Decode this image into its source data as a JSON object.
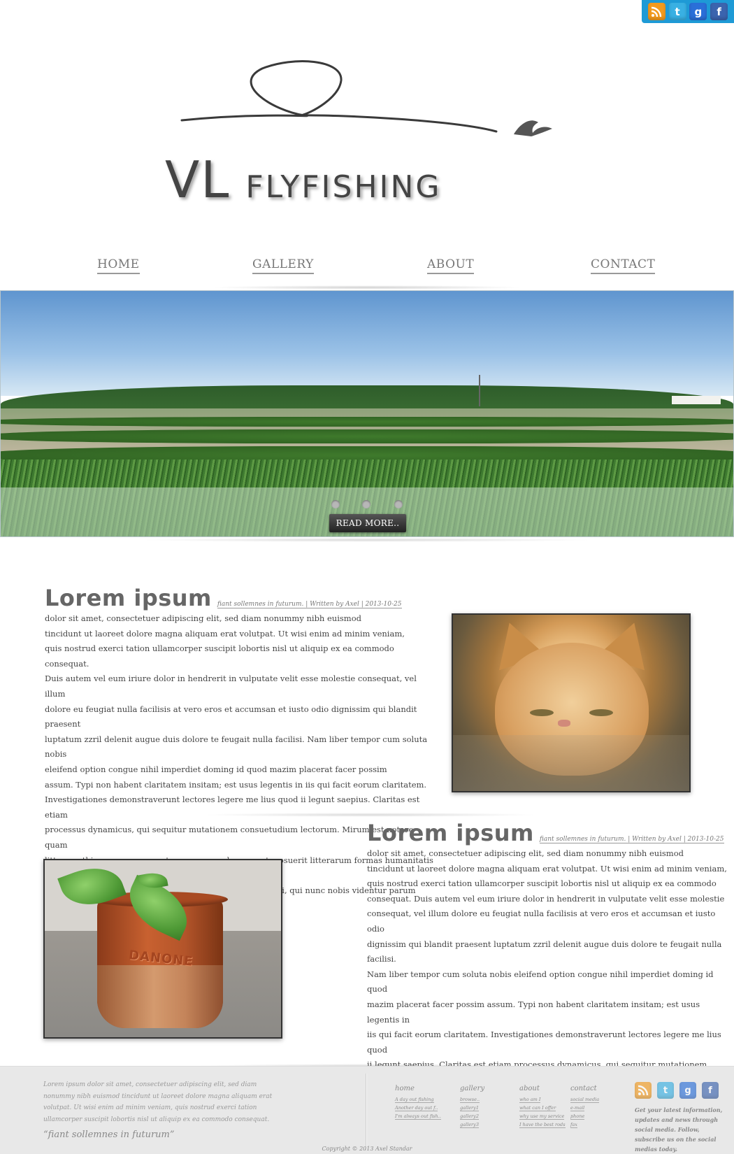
{
  "logo": {
    "vl": "VL",
    "flyfishing": "FLYFISHING"
  },
  "social_top": [
    {
      "icon": "rss-icon",
      "glyph": "",
      "color": "#f29a1e"
    },
    {
      "icon": "twitter-icon",
      "glyph": "t",
      "color": "#39b0e3"
    },
    {
      "icon": "google-plus-icon",
      "glyph": "g",
      "color": "#2a6fd8"
    },
    {
      "icon": "facebook-icon",
      "glyph": "f",
      "color": "#3b64ae"
    }
  ],
  "nav": {
    "home": "HOME",
    "gallery": "GALLERY",
    "about": "ABOUT",
    "contact": "CONTACT"
  },
  "hero": {
    "read_more": "READ MORE..",
    "slides": 3
  },
  "articles": [
    {
      "title": "Lorem ipsum",
      "meta": "fiant sollemnes in futurum. | Written by Axel | 2013-10-25",
      "body": "dolor sit amet, consectetuer adipiscing elit, sed diam nonummy nibh euismod\ntincidunt ut laoreet dolore magna aliquam erat volutpat. Ut wisi enim ad minim  veniam,\nquis nostrud exerci tation ullamcorper suscipit lobortis nisl ut aliquip ex ea commodo consequat.\nDuis autem vel eum iriure dolor in hendrerit in vulputate velit esse molestie consequat, vel illum\n dolore eu feugiat nulla facilisis at vero eros et accumsan et iusto odio dignissim qui blandit praesent\nluptatum zzril delenit augue duis dolore te feugait nulla facilisi. Nam liber tempor cum soluta nobis\neleifend option congue nihil imperdiet doming id quod mazim placerat facer possim\nassum. Typi non habent claritatem insitam; est usus legentis in iis qui facit eorum claritatem.\nInvestigationes demonstraverunt lectores legere me lius quod ii legunt saepius. Claritas est etiam\nprocessus dynamicus, qui sequitur mutationem consuetudium lectorum. Mirum est notare quam\nlittera gothica, quam nunc putamus parum claram, anteposuerit litterarum formas humanitatis per\nseacula quarta decima et quinta decima. Eodem modo typi, qui nunc nobis videntur parum clari,"
    },
    {
      "title": "Lorem ipsum",
      "meta": "fiant sollemnes in futurum. | Written by Axel | 2013-10-25",
      "body": "dolor sit amet, consectetuer adipiscing elit, sed diam nonummy nibh euismod\ntincidunt ut laoreet dolore magna aliquam erat volutpat. Ut wisi enim ad minim  veniam,\nquis nostrud exerci tation ullamcorper suscipit lobortis nisl ut aliquip ex ea commodo\nconsequat. Duis autem vel eum iriure dolor in hendrerit in vulputate velit esse molestie\nconsequat, vel illum dolore eu feugiat nulla facilisis at vero eros et accumsan et iusto odio\ndignissim qui blandit praesent luptatum zzril delenit augue duis dolore te feugait nulla facilisi.\nNam liber tempor cum soluta nobis eleifend option congue nihil imperdiet doming id quod\nmazim placerat facer possim assum. Typi non habent claritatem insitam; est usus legentis in\niis qui facit eorum claritatem. Investigationes demonstraverunt lectores legere me lius quod\nii legunt saepius. Claritas est etiam processus dynamicus, qui sequitur mutationem\nconsuetudium lectorum. Mirum est notare quam littera gothica, quam nunc putamus\nparum claram, anteposuerit litterarum formas humanitatis per seacula quarta decima et\nquinta decima. Eodem modo typi, qui nunc nobis videntur parum clari,"
    }
  ],
  "photo2_text": "DANONE",
  "footer": {
    "text": "Lorem ipsum dolor sit amet, consectetuer adipiscing elit, sed diam nonummy nibh euismod tincidunt ut laoreet dolore magna aliquam erat volutpat. Ut wisi enim ad minim veniam, quis nostrud exerci tation ullamcorper suscipit lobortis nisl ut aliquip ex ea commodo consequat.",
    "quote": "“fiant sollemnes in futurum”",
    "columns": [
      {
        "title": "home",
        "links": [
          "A day out fishing",
          "Another day out f..",
          "I'm always out fish.."
        ]
      },
      {
        "title": "gallery",
        "links": [
          "browse..",
          "gallery1",
          "gallery2",
          "gallery3"
        ]
      },
      {
        "title": "about",
        "links": [
          "who am I",
          "what can I offer",
          "why use my service",
          "I have the best rods"
        ]
      },
      {
        "title": "contact",
        "links": [
          "social media",
          "e-mail",
          "phone",
          "fax"
        ]
      }
    ],
    "social_text": "Get your latest information, updates and news through social media. Follow, subscribe us on the social medias today.",
    "copyright": "Copyright © 2013 Axel Standar"
  }
}
